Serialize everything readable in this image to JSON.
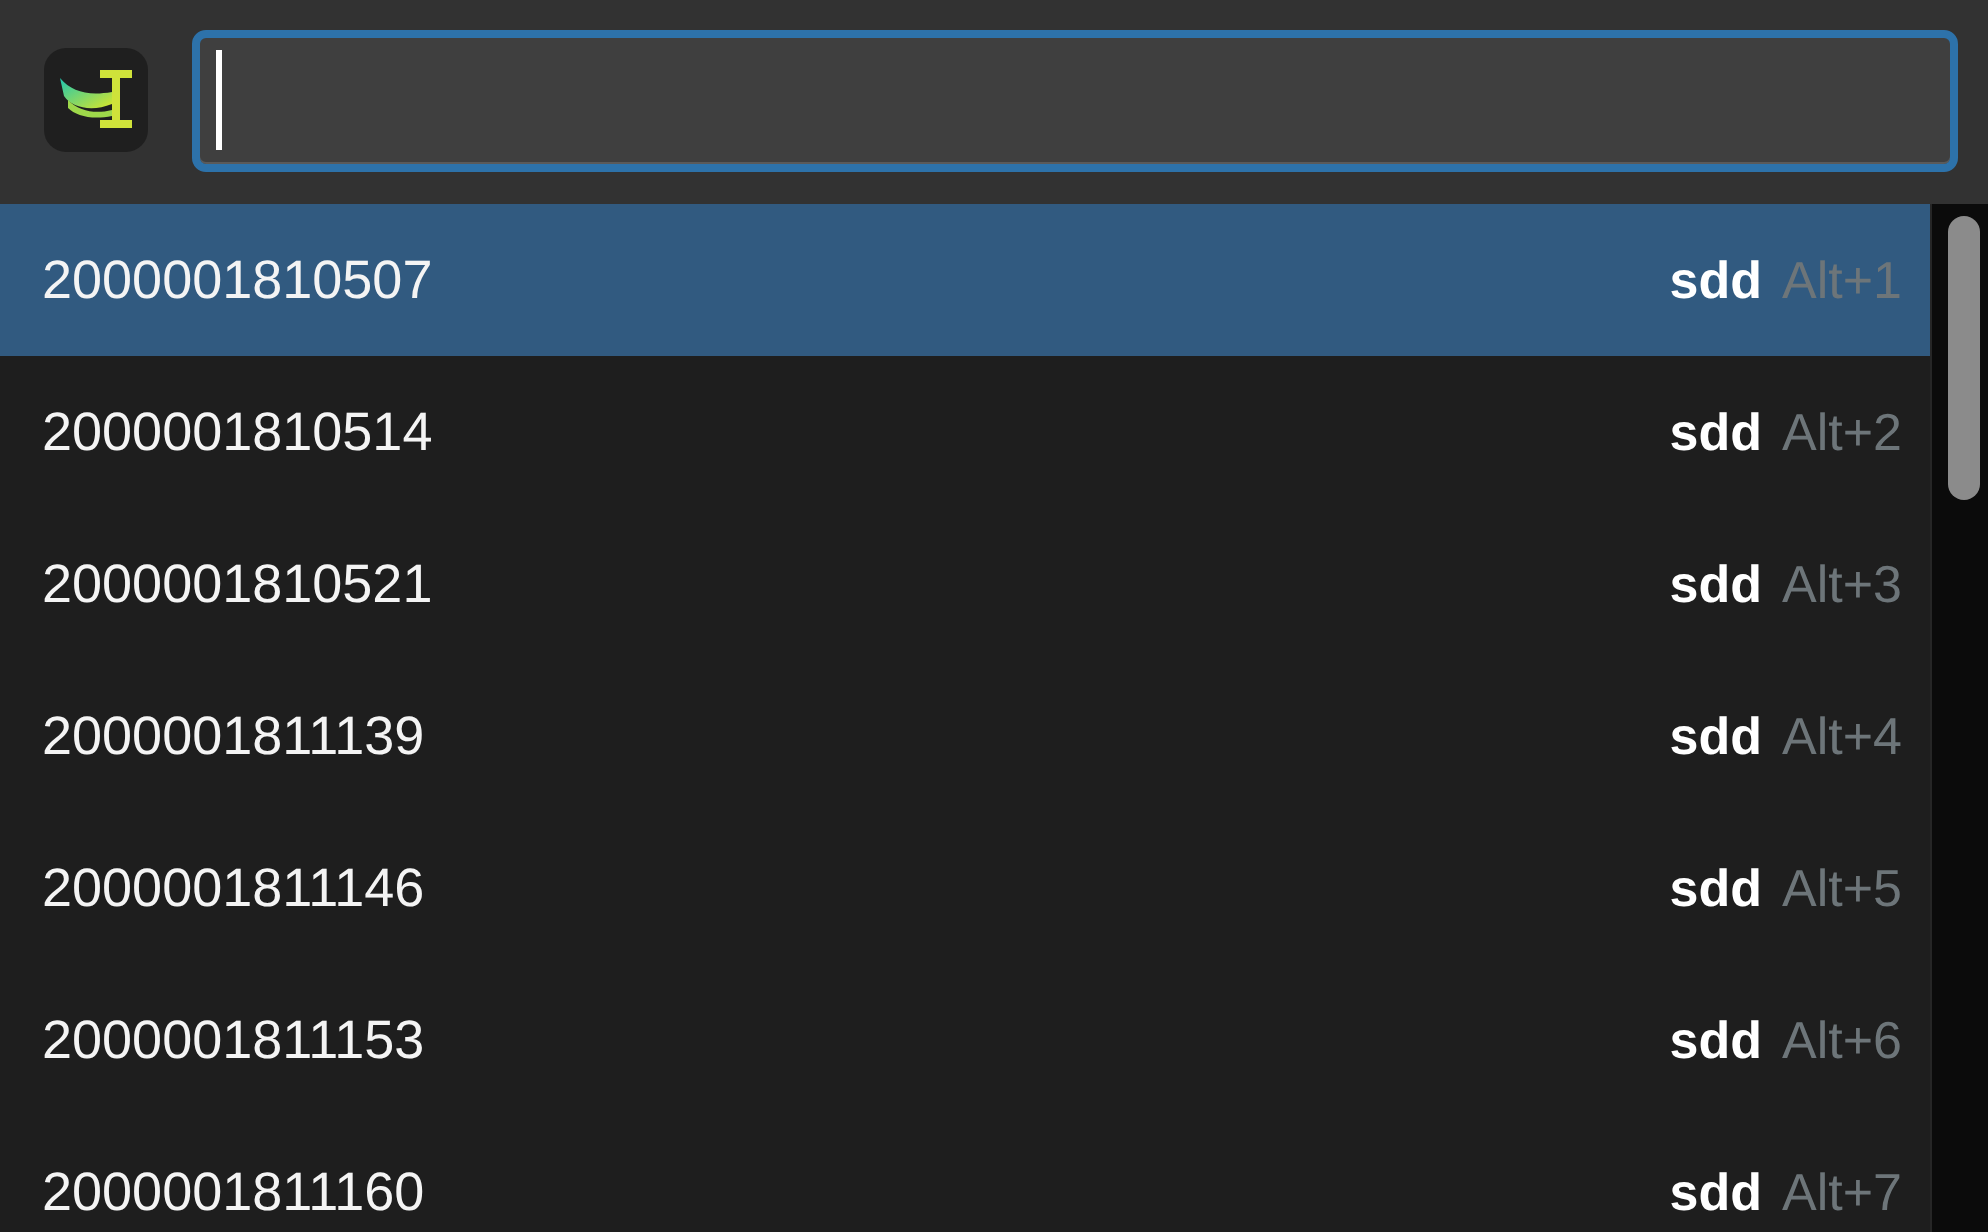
{
  "search": {
    "focused": true
  },
  "results": [
    {
      "text": "2000001810507",
      "tag": "sdd",
      "shortcut": "Alt+1",
      "selected": true
    },
    {
      "text": "2000001810514",
      "tag": "sdd",
      "shortcut": "Alt+2",
      "selected": false
    },
    {
      "text": "2000001810521",
      "tag": "sdd",
      "shortcut": "Alt+3",
      "selected": false
    },
    {
      "text": "2000001811139",
      "tag": "sdd",
      "shortcut": "Alt+4",
      "selected": false
    },
    {
      "text": "2000001811146",
      "tag": "sdd",
      "shortcut": "Alt+5",
      "selected": false
    },
    {
      "text": "2000001811153",
      "tag": "sdd",
      "shortcut": "Alt+6",
      "selected": false
    },
    {
      "text": "2000001811160",
      "tag": "sdd",
      "shortcut": "Alt+7",
      "selected": false
    }
  ]
}
